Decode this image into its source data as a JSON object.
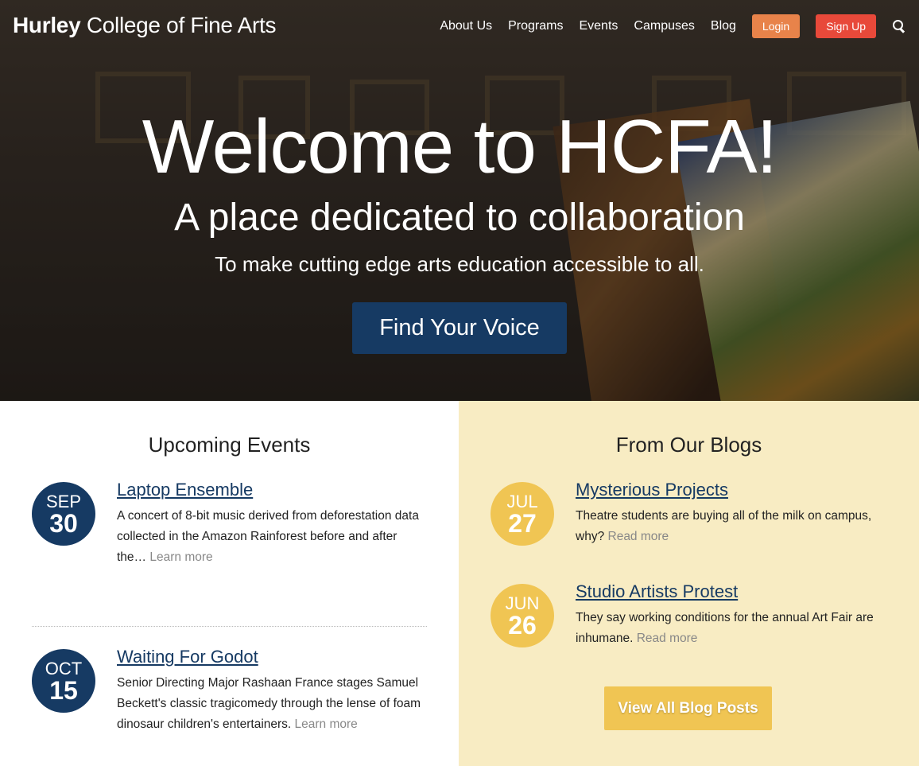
{
  "nav": {
    "brand_bold": "Hurley",
    "brand_light": "College of Fine Arts",
    "links": [
      "About Us",
      "Programs",
      "Events",
      "Campuses",
      "Blog"
    ],
    "login_label": "Login",
    "signup_label": "Sign Up",
    "login_color": "#e8834a",
    "signup_color": "#e8493a"
  },
  "hero": {
    "title": "Welcome to HCFA!",
    "subtitle": "A place dedicated to collaboration",
    "tagline": "To make cutting edge arts education accessible to all.",
    "cta_label": "Find Your Voice",
    "cta_color": "#163a63"
  },
  "events": {
    "heading": "Upcoming Events",
    "items": [
      {
        "month": "SEP",
        "day": "30",
        "title": "Laptop Ensemble",
        "description": "A concert of 8-bit music derived from deforestation data collected in the Amazon Rainforest before and after the…",
        "more_label": "Learn more"
      },
      {
        "month": "OCT",
        "day": "15",
        "title": "Waiting For Godot",
        "description": "Senior Directing Major Rashaan France stages Samuel Beckett's classic tragicomedy through the lense of foam dinosaur children's entertainers.",
        "more_label": "Learn more"
      }
    ]
  },
  "blog": {
    "heading": "From Our Blogs",
    "items": [
      {
        "month": "JUL",
        "day": "27",
        "title": "Mysterious Projects",
        "description": "Theatre students are buying all of the milk on campus, why?",
        "more_label": "Read more"
      },
      {
        "month": "JUN",
        "day": "26",
        "title": "Studio Artists Protest",
        "description": "They say working conditions for the annual Art Fair are inhumane.",
        "more_label": "Read more"
      }
    ],
    "view_all_label": "View All Blog Posts",
    "accent_color": "#f0c553",
    "background_color": "#f8ecc3"
  },
  "icons": {
    "search": "search-icon"
  }
}
